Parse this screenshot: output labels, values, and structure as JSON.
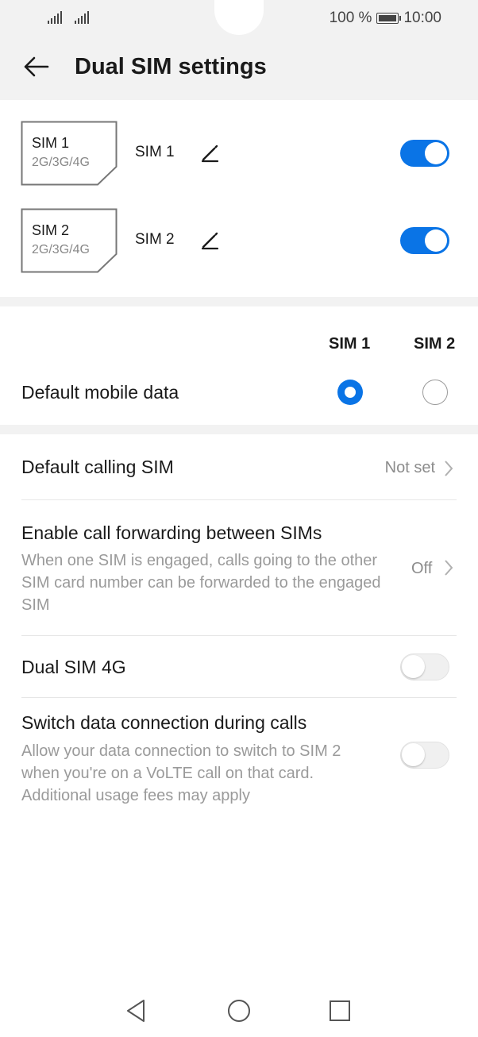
{
  "status_bar": {
    "battery_text": "100 %",
    "time": "10:00"
  },
  "header": {
    "title": "Dual SIM settings",
    "back_icon": "arrow-left-icon"
  },
  "sims": [
    {
      "card_name": "SIM 1",
      "card_network": "2G/3G/4G",
      "label": "SIM 1",
      "enabled": true
    },
    {
      "card_name": "SIM 2",
      "card_network": "2G/3G/4G",
      "label": "SIM 2",
      "enabled": true
    }
  ],
  "default_data": {
    "col_sim1": "SIM 1",
    "col_sim2": "SIM 2",
    "label": "Default mobile data",
    "selected": "SIM 1"
  },
  "settings": {
    "default_calling": {
      "title": "Default calling SIM",
      "value": "Not set"
    },
    "call_forwarding": {
      "title": "Enable call forwarding between SIMs",
      "description": "When one SIM is engaged, calls going to the other SIM card number can be forwarded to the engaged SIM",
      "value": "Off"
    },
    "dual_4g": {
      "title": "Dual SIM 4G",
      "enabled": false
    },
    "switch_data": {
      "title": "Switch data connection during calls",
      "description": "Allow your data connection to switch to SIM 2 when you're on a VoLTE call on that card. Additional usage fees may apply",
      "enabled": false
    }
  },
  "colors": {
    "accent": "#0a74e6",
    "header_bg": "#f2f2f2",
    "secondary_text": "#9a9a9a"
  },
  "nav_icons": [
    "back-triangle-icon",
    "home-circle-icon",
    "recents-square-icon"
  ]
}
